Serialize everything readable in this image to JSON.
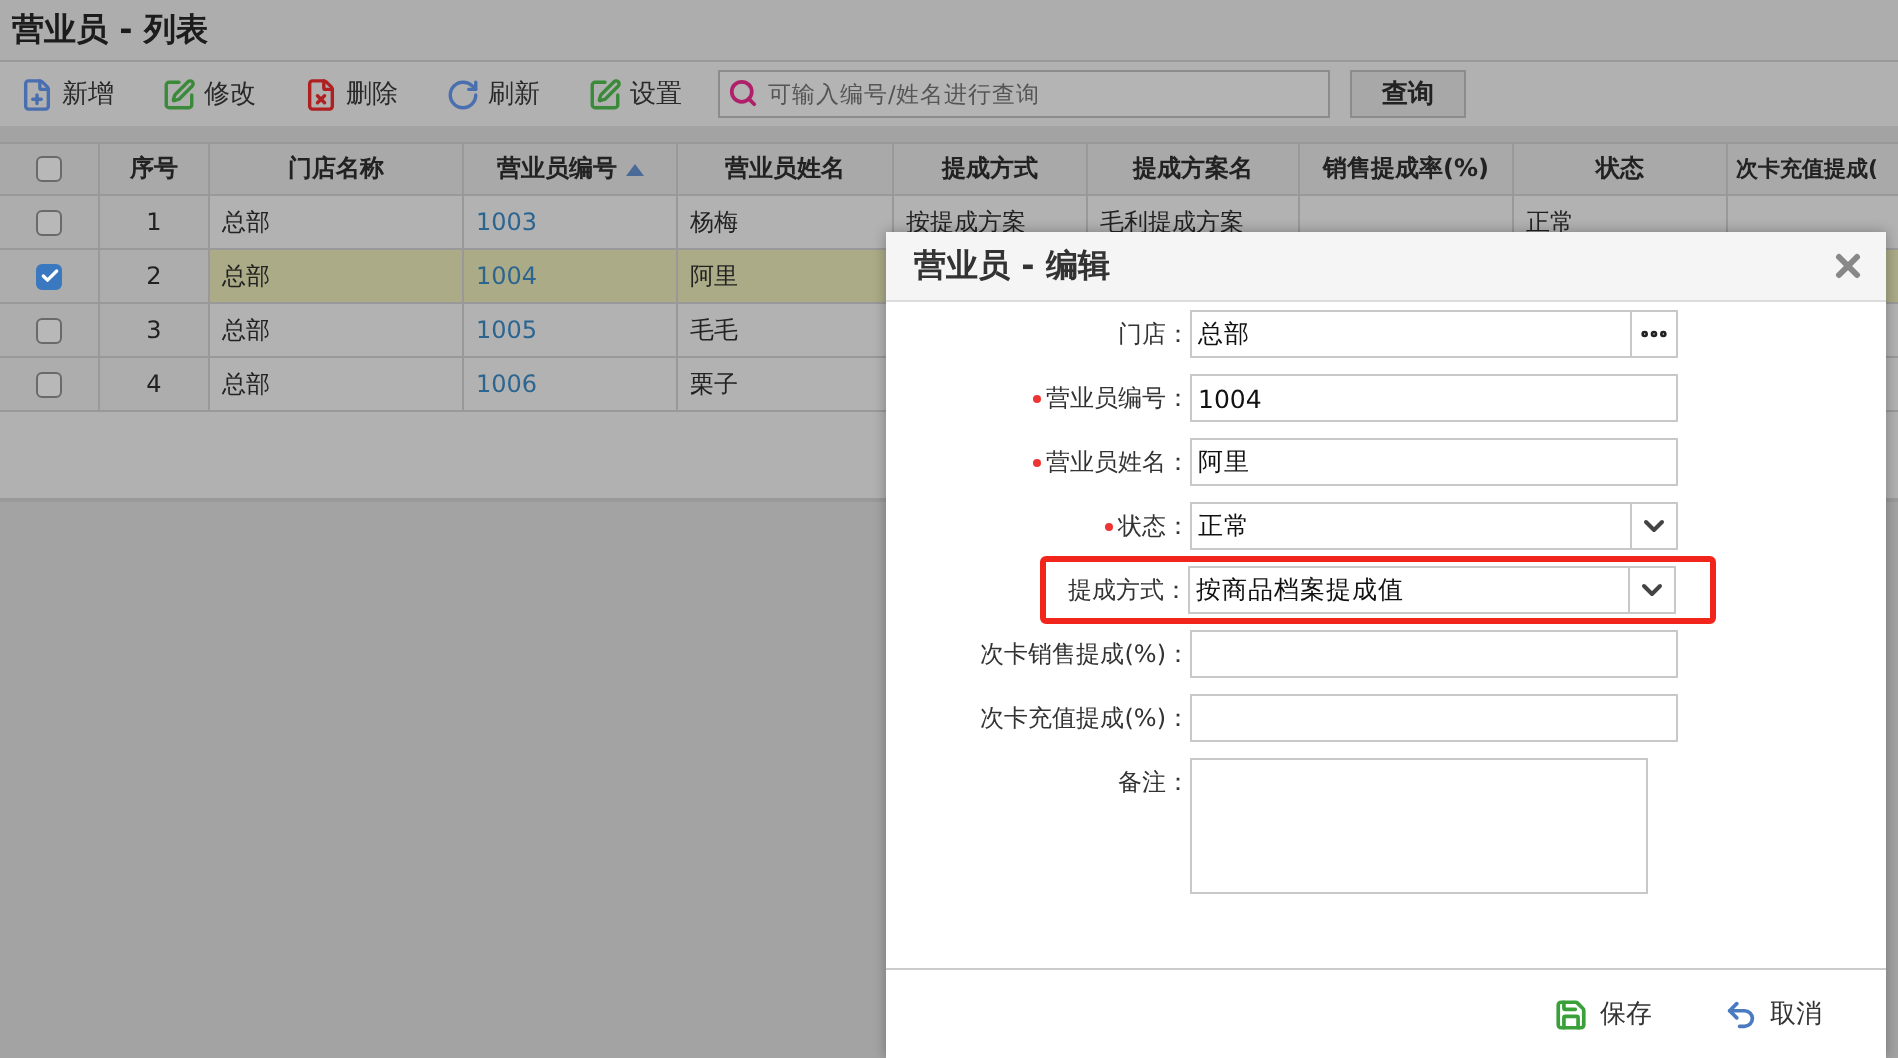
{
  "page": {
    "title": "营业员 - 列表"
  },
  "toolbar": {
    "buttons": [
      {
        "kind": "add",
        "label": "新增"
      },
      {
        "kind": "edit",
        "label": "修改"
      },
      {
        "kind": "delete",
        "label": "删除"
      },
      {
        "kind": "refresh",
        "label": "刷新"
      },
      {
        "kind": "settings",
        "label": "设置"
      }
    ],
    "search": {
      "placeholder": "可输入编号/姓名进行查询"
    },
    "query_button": "查询"
  },
  "table": {
    "header_checked": false,
    "columns": [
      {
        "label": "序号",
        "sorted": false
      },
      {
        "label": "门店名称",
        "sorted": false
      },
      {
        "label": "营业员编号",
        "sorted": true
      },
      {
        "label": "营业员姓名",
        "sorted": false
      },
      {
        "label": "提成方式",
        "sorted": false
      },
      {
        "label": "提成方案名",
        "sorted": false
      },
      {
        "label": "销售提成率(%)",
        "sorted": false
      },
      {
        "label": "状态",
        "sorted": false
      },
      {
        "label": "次卡充值提成(",
        "sorted": false
      }
    ],
    "rows": [
      {
        "selected": false,
        "checked": false,
        "cells": [
          "1",
          "总部",
          "1003",
          "杨梅",
          "按提成方案",
          "毛利提成方案",
          null,
          "正常"
        ]
      },
      {
        "selected": true,
        "checked": true,
        "cells": [
          "2",
          "总部",
          "1004",
          "阿里"
        ]
      },
      {
        "selected": false,
        "checked": false,
        "cells": [
          "3",
          "总部",
          "1005",
          "毛毛"
        ]
      },
      {
        "selected": false,
        "checked": false,
        "cells": [
          "4",
          "总部",
          "1006",
          "栗子"
        ]
      }
    ]
  },
  "dialog": {
    "title": "营业员 - 编辑",
    "fields": [
      {
        "kind": "picker",
        "label": "门店：",
        "required": false,
        "highlighted": false,
        "value": "总部"
      },
      {
        "kind": "text",
        "label": "营业员编号：",
        "required": true,
        "highlighted": false,
        "value": "1004"
      },
      {
        "kind": "text",
        "label": "营业员姓名：",
        "required": true,
        "highlighted": false,
        "value": "阿里"
      },
      {
        "kind": "select",
        "label": "状态：",
        "required": true,
        "highlighted": false,
        "value": "正常"
      },
      {
        "kind": "select",
        "label": "提成方式：",
        "required": false,
        "highlighted": true,
        "value": "按商品档案提成值"
      },
      {
        "kind": "text",
        "label": "次卡销售提成(%)：",
        "required": false,
        "highlighted": false
      },
      {
        "kind": "text",
        "label": "次卡充值提成(%)：",
        "required": false,
        "highlighted": false
      },
      {
        "kind": "textarea",
        "label": "备注：",
        "required": false,
        "highlighted": false
      }
    ],
    "buttons": [
      {
        "kind": "save",
        "label": "保存"
      },
      {
        "kind": "cancel",
        "label": "取消"
      }
    ]
  }
}
